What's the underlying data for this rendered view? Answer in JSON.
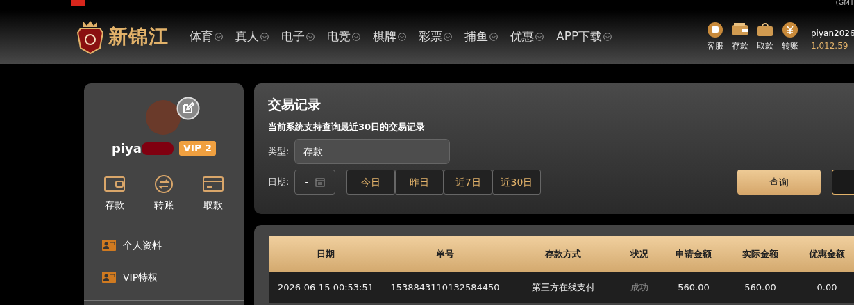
{
  "topbar": {
    "timezone": "(GMT"
  },
  "header": {
    "logo_text": "新锦江",
    "nav": [
      {
        "label": "体育"
      },
      {
        "label": "真人"
      },
      {
        "label": "电子"
      },
      {
        "label": "电竞"
      },
      {
        "label": "棋牌"
      },
      {
        "label": "彩票"
      },
      {
        "label": "捕鱼"
      },
      {
        "label": "优惠"
      },
      {
        "label": "APP下载"
      }
    ],
    "actions": [
      {
        "kind": "chat",
        "label": "客服"
      },
      {
        "kind": "wallet",
        "label": "存款"
      },
      {
        "kind": "case",
        "label": "取款"
      },
      {
        "kind": "coin",
        "label": "转账"
      }
    ],
    "username": "piyan2026",
    "balance": "1,012.59"
  },
  "sidebar": {
    "username": "piya",
    "vip": "VIP 2",
    "quick": [
      {
        "kind": "wallet",
        "label": "存款"
      },
      {
        "kind": "transfer",
        "label": "转账"
      },
      {
        "kind": "card",
        "label": "取款"
      }
    ],
    "menu": [
      {
        "label": "个人资料"
      },
      {
        "label": "VIP特权"
      }
    ]
  },
  "filter": {
    "title": "交易记录",
    "note": "当前系统支持查询最近30日的交易记录",
    "type_label": "类型:",
    "type_value": "存款",
    "date_label": "日期:",
    "date_value": "-",
    "ranges": [
      {
        "label": "今日"
      },
      {
        "label": "昨日"
      },
      {
        "label": "近7日"
      },
      {
        "label": "近30日"
      }
    ],
    "search": "查询"
  },
  "table": {
    "columns": [
      "日期",
      "单号",
      "存款方式",
      "状况",
      "申请金额",
      "实际金额",
      "优惠金额"
    ],
    "rows": [
      [
        "2026-06-15 00:53:51",
        "1538843110132584450",
        "第三方在线支付",
        "成功",
        "560.00",
        "560.00",
        "0.00"
      ]
    ]
  }
}
